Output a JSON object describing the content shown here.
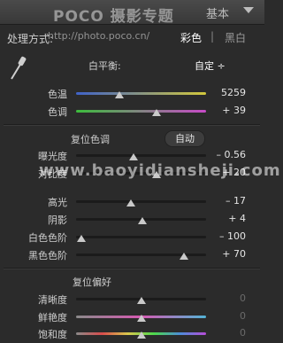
{
  "header": {
    "watermark": "POCO 摄影专题",
    "title": "基本"
  },
  "treatment": {
    "label": "处理方式:",
    "url_watermark": "http://photo.poco.cn/",
    "color": "彩色",
    "separator": "|",
    "bw": "黑白"
  },
  "white_balance": {
    "label": "白平衡:",
    "value": "自定 ÷"
  },
  "wb_rows": [
    {
      "label": "色温",
      "value": "5259",
      "pos": 0.33,
      "track": "linear-gradient(90deg,#3f62c8,#d2c83c)"
    },
    {
      "label": "色调",
      "value": "+ 39",
      "pos": 0.62,
      "track": "linear-gradient(90deg,#3cbc3c,#c84ac8)"
    }
  ],
  "tone": {
    "header": "复位色调",
    "auto": "自动",
    "watermark": "www.baoyidiansheji.com",
    "rows": [
      {
        "label": "曝光度",
        "value": "– 0.56",
        "pos": 0.44
      },
      {
        "label": "对比度",
        "value": "+ 20",
        "pos": 0.62
      },
      {
        "label": "高光",
        "value": "– 17",
        "pos": 0.42
      },
      {
        "label": "阴影",
        "value": "+ 4",
        "pos": 0.51
      },
      {
        "label": "白色色阶",
        "value": "– 100",
        "pos": 0.04
      },
      {
        "label": "黑色色阶",
        "value": "+ 70",
        "pos": 0.83
      }
    ]
  },
  "presence": {
    "header": "复位偏好",
    "rows": [
      {
        "label": "清晰度",
        "value": "0",
        "pos": 0.5,
        "track": "#1b1b1b"
      },
      {
        "label": "鲜艳度",
        "value": "0",
        "pos": 0.5,
        "track": "linear-gradient(90deg,#8a8a8a,#d65ab2,#52b3d6)"
      },
      {
        "label": "饱和度",
        "value": "0",
        "pos": 0.5,
        "track": "linear-gradient(90deg,#8a8a8a,#d84c4c,#d8c84c,#4cd84c,#4c8cd8,#b84cd8)"
      }
    ]
  }
}
